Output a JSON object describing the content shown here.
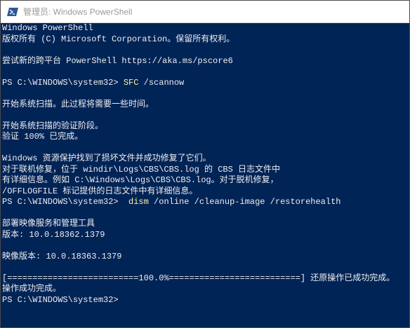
{
  "window": {
    "title": "管理员: Windows PowerShell",
    "icon": "powershell-icon",
    "background_color": "#012456",
    "text_color": "#eeedf0",
    "command_color": "#f9f1a5"
  },
  "console": {
    "lines": [
      {
        "text": "Windows PowerShell"
      },
      {
        "text": "版权所有 (C) Microsoft Corporation。保留所有权利。"
      },
      {
        "text": ""
      },
      {
        "text": "尝试新的跨平台 PowerShell https://aka.ms/pscore6"
      },
      {
        "text": ""
      },
      {
        "prompt": "PS C:\\WINDOWS\\system32> ",
        "command": "SFC",
        "args": " /scannow"
      },
      {
        "text": ""
      },
      {
        "text": "开始系统扫描。此过程将需要一些时间。"
      },
      {
        "text": ""
      },
      {
        "text": "开始系统扫描的验证阶段。"
      },
      {
        "text": "验证 100% 已完成。"
      },
      {
        "text": ""
      },
      {
        "text": "Windows 资源保护找到了损坏文件并成功修复了它们。"
      },
      {
        "text": "对于联机修复，位于 windir\\Logs\\CBS\\CBS.log 的 CBS 日志文件中"
      },
      {
        "text": "有详细信息。例如 C:\\Windows\\Logs\\CBS\\CBS.log。对于脱机修复，"
      },
      {
        "text": "/OFFLOGFILE 标记提供的日志文件中有详细信息。"
      },
      {
        "prompt": "PS C:\\WINDOWS\\system32> ",
        "command": " dism",
        "args": " /online /cleanup-image /restorehealth"
      },
      {
        "text": ""
      },
      {
        "text": "部署映像服务和管理工具"
      },
      {
        "text": "版本: 10.0.18362.1379"
      },
      {
        "text": ""
      },
      {
        "text": "映像版本: 10.0.18363.1379"
      },
      {
        "text": ""
      },
      {
        "text": "[==========================100.0%==========================] 还原操作已成功完成。"
      },
      {
        "text": "操作成功完成。"
      },
      {
        "text": "PS C:\\WINDOWS\\system32>"
      }
    ]
  }
}
